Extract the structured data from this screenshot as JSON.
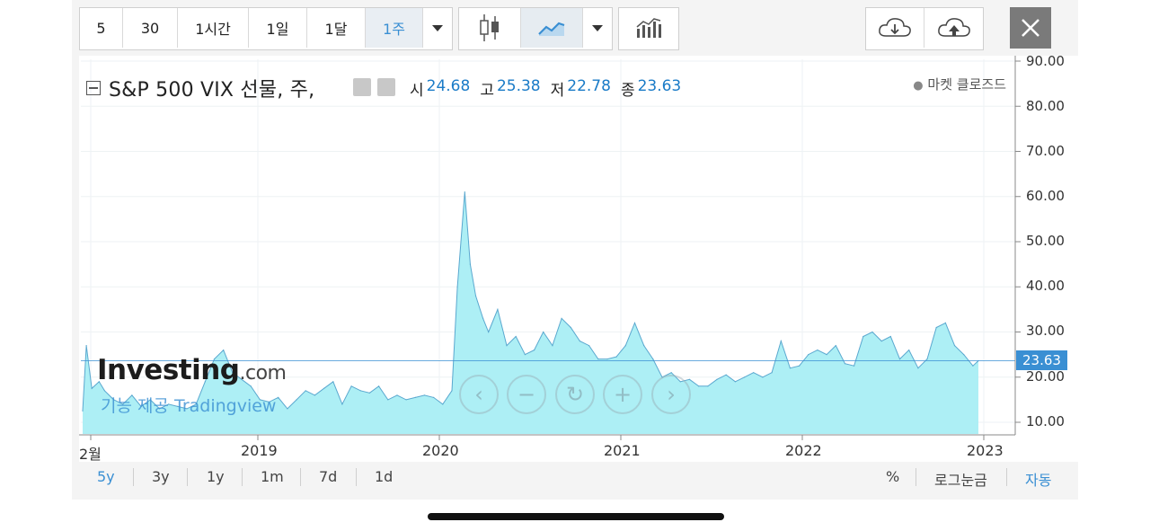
{
  "toolbar": {
    "intervals": [
      "5",
      "30",
      "1시간",
      "1일",
      "1달",
      "1주"
    ],
    "active_interval": "1주"
  },
  "chart": {
    "title": "S&P 500 VIX 선물, 주,",
    "ohlc": {
      "open_label": "시",
      "open": "24.68",
      "high_label": "고",
      "high": "25.38",
      "low_label": "저",
      "low": "22.78",
      "close_label": "종",
      "close": "23.63"
    },
    "market_status": "마켓 클로즈드",
    "price_tag": "23.63",
    "watermark_brand": "Investing",
    "watermark_domain": ".com",
    "watermark_sub": "기능 제공 Tradingview",
    "accent_color": "#3a8fd3",
    "area_color": "#a9eef4"
  },
  "ranges": [
    "5y",
    "3y",
    "1y",
    "1m",
    "7d",
    "1d"
  ],
  "active_range": "5y",
  "bottom_right": {
    "percent": "%",
    "log": "로그눈금",
    "auto": "자동"
  },
  "chart_data": {
    "type": "area",
    "y_ticks": [
      "90.00",
      "80.00",
      "70.00",
      "60.00",
      "50.00",
      "40.00",
      "30.00",
      "20.00",
      "10.00"
    ],
    "x_ticks": [
      "2월",
      "2019",
      "2020",
      "2021",
      "2022",
      "2023"
    ],
    "ylim": [
      5,
      92
    ],
    "x": [
      2018.08,
      2018.1,
      2018.13,
      2018.17,
      2018.2,
      2018.25,
      2018.3,
      2018.35,
      2018.4,
      2018.45,
      2018.5,
      2018.55,
      2018.6,
      2018.65,
      2018.7,
      2018.75,
      2018.8,
      2018.85,
      2018.9,
      2018.95,
      2019.0,
      2019.05,
      2019.1,
      2019.15,
      2019.2,
      2019.25,
      2019.3,
      2019.35,
      2019.4,
      2019.45,
      2019.5,
      2019.55,
      2019.6,
      2019.65,
      2019.7,
      2019.75,
      2019.8,
      2019.85,
      2019.9,
      2019.95,
      2020.0,
      2020.05,
      2020.1,
      2020.13,
      2020.17,
      2020.2,
      2020.23,
      2020.27,
      2020.3,
      2020.35,
      2020.4,
      2020.45,
      2020.5,
      2020.55,
      2020.6,
      2020.65,
      2020.7,
      2020.75,
      2020.8,
      2020.85,
      2020.9,
      2020.95,
      2021.0,
      2021.05,
      2021.1,
      2021.15,
      2021.2,
      2021.25,
      2021.3,
      2021.35,
      2021.4,
      2021.45,
      2021.5,
      2021.55,
      2021.6,
      2021.65,
      2021.7,
      2021.75,
      2021.8,
      2021.85,
      2021.9,
      2021.95,
      2022.0,
      2022.05,
      2022.1,
      2022.15,
      2022.2,
      2022.25,
      2022.3,
      2022.35,
      2022.4,
      2022.45,
      2022.5,
      2022.55,
      2022.6,
      2022.65,
      2022.7,
      2022.75,
      2022.8,
      2022.85,
      2022.9,
      2022.95,
      2022.98
    ],
    "series": [
      {
        "values": [
          12.5,
          27,
          17.5,
          19,
          17,
          15,
          14,
          16,
          13.5,
          15,
          13,
          14,
          13.5,
          13,
          14,
          19,
          24,
          26,
          21,
          19.5,
          18,
          15,
          14.5,
          15.5,
          13,
          15,
          17,
          16,
          17.5,
          19,
          14,
          18,
          17,
          16.5,
          18,
          15,
          16,
          15,
          15.5,
          16,
          15.5,
          14,
          17,
          40,
          61,
          45,
          38,
          33,
          30,
          35,
          27,
          29,
          25,
          26,
          30,
          27,
          33,
          31,
          28,
          27,
          24,
          24,
          24.5,
          27,
          32,
          27,
          24,
          20,
          21,
          19,
          19.5,
          18,
          18,
          19.5,
          20.5,
          19,
          20,
          21,
          20,
          21,
          28,
          22,
          22.5,
          25,
          26,
          25,
          27,
          23,
          22.5,
          29,
          30,
          28,
          29,
          24,
          26,
          22,
          24,
          31,
          32,
          27,
          25,
          22.5,
          23.63
        ]
      }
    ]
  }
}
